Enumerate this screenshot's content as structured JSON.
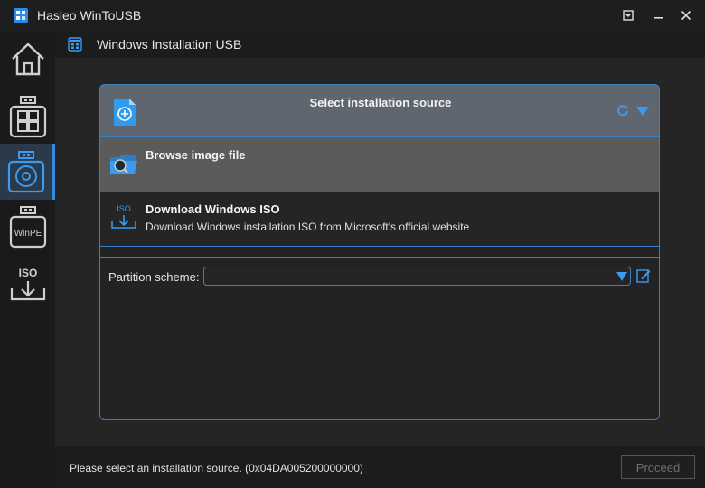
{
  "window": {
    "title": "Hasleo WinToUSB",
    "icons": [
      "app-icon",
      "pin-icon",
      "minimize-icon",
      "close-icon"
    ]
  },
  "sidebar": {
    "items": [
      {
        "name": "home",
        "icon": "home-icon",
        "label": ""
      },
      {
        "name": "windows-to-go",
        "icon": "windows-usb-icon",
        "label": ""
      },
      {
        "name": "installation-usb",
        "icon": "disc-usb-icon",
        "label": "",
        "active": true
      },
      {
        "name": "winpe",
        "icon": "winpe-usb-icon",
        "label": "WinPE"
      },
      {
        "name": "iso-download",
        "icon": "iso-download-icon",
        "label": "ISO"
      }
    ]
  },
  "header": {
    "title": "Windows Installation USB"
  },
  "source": {
    "label": "Select installation source",
    "options": [
      {
        "title": "Browse image file",
        "description": ""
      },
      {
        "title": "Download Windows ISO",
        "description": "Download Windows installation ISO from Microsoft's official website",
        "icon_label": "ISO"
      }
    ]
  },
  "partition": {
    "label": "Partition scheme:",
    "value": ""
  },
  "status": {
    "message": "Please select an installation source. (0x04DA005200000000)"
  },
  "buttons": {
    "proceed": "Proceed"
  },
  "colors": {
    "accent": "#3a80c4",
    "header_bg": "#5f6670",
    "hover_bg": "#5b5b5b"
  }
}
